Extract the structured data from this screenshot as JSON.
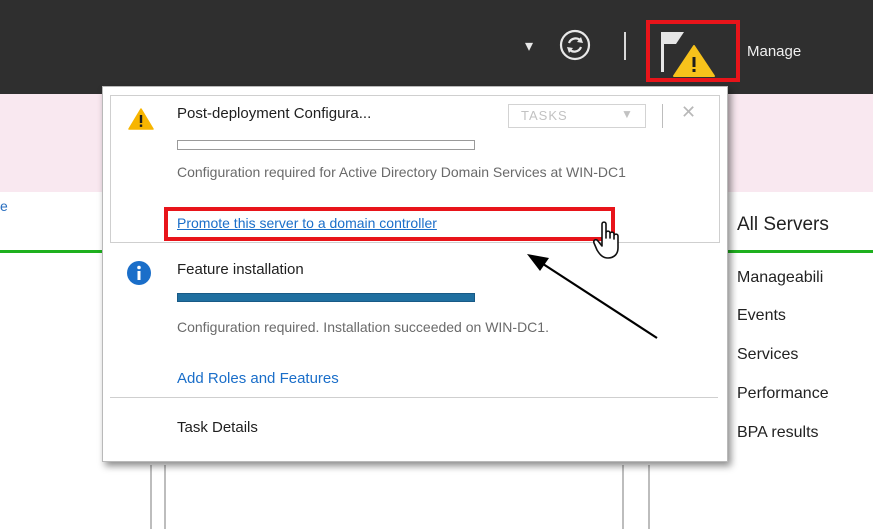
{
  "header": {
    "manage_label": "Manage",
    "refresh_icon": "refresh-icon",
    "flag_icon": "notifications-flag-warning-icon",
    "highlight_color": "#e8141a"
  },
  "background": {
    "right_panel": {
      "title": "All Servers",
      "items": [
        "Manageabili",
        "Events",
        "Services",
        "Performance",
        "BPA results"
      ]
    },
    "left_fragment": "e"
  },
  "notifications": {
    "post_deployment": {
      "icon": "warning-icon",
      "title": "Post-deployment Configura...",
      "tasks_label": "TASKS",
      "progress": 0,
      "description": "Configuration required for Active Directory Domain Services at WIN-DC1",
      "link": "Promote this server to a domain controller"
    },
    "feature_installation": {
      "icon": "info-icon",
      "title": "Feature installation",
      "progress": 1.0,
      "description": "Configuration required. Installation succeeded on WIN-DC1.",
      "link": "Add Roles and Features"
    },
    "task_details": "Task Details"
  }
}
